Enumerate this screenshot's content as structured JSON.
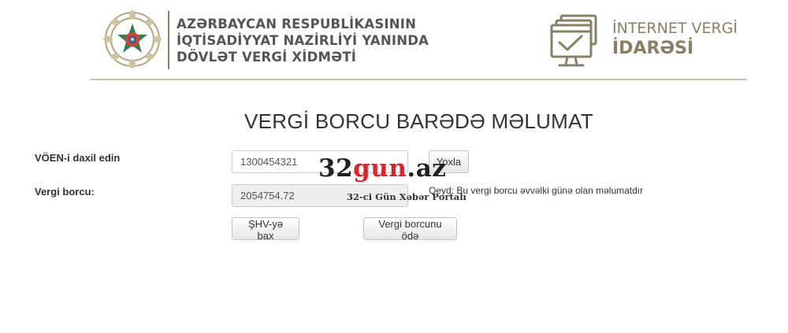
{
  "header": {
    "agency_lines": [
      "AZƏRBAYCAN RESPUBLİKASININ",
      "İQTİSADİYYAT NAZİRLİYİ YANINDA",
      "DÖVLƏT VERGİ XİDMƏTİ"
    ],
    "portal_lines": [
      "İNTERNET VERGİ",
      "İDARƏSİ"
    ],
    "emblem_icon": "state-emblem-icon",
    "portal_icon": "monitor-checkmark-icon",
    "accent_color": "#8a7f62"
  },
  "main": {
    "title": "VERGİ BORCU BARƏDƏ MƏLUMAT",
    "voen_label": "VÖEN-i daxil edin",
    "voen_value": "1300454321",
    "check_button": "Yoxla",
    "debt_label": "Vergi borcu:",
    "debt_value": "2054754.72",
    "note": "Qeyd: Bu vergi borcu əvvəlki günə olan məlumatdır",
    "view_button": "ŞHV-yə bax",
    "pay_button": "Vergi borcunu ödə"
  },
  "watermark": {
    "part1": "32",
    "part2": "gun",
    "part3": ".az",
    "subtitle": "32-ci Gün Xəbər Portalı",
    "color_dark": "#222222",
    "color_red": "#d8262d"
  }
}
